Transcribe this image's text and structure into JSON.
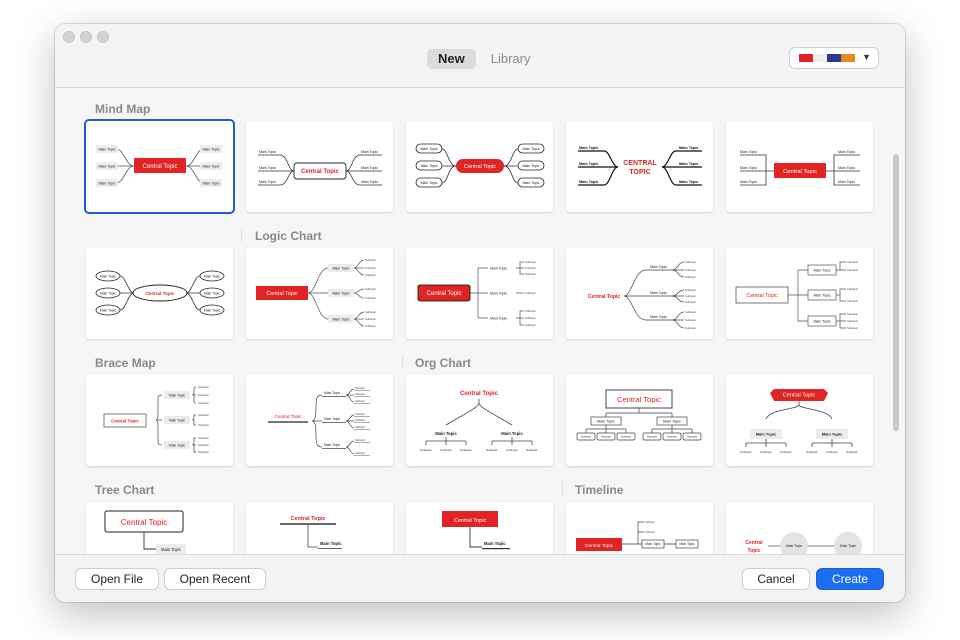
{
  "tabs": [
    {
      "label": "New",
      "active": true
    },
    {
      "label": "Library",
      "active": false
    }
  ],
  "theme_swatches": [
    "#e02424",
    "#f0f0f0",
    "#2a3a9a",
    "#e88a1a"
  ],
  "sections": {
    "mind_map": "Mind Map",
    "logic_chart": "Logic Chart",
    "brace_map": "Brace Map",
    "org_chart": "Org Chart",
    "tree_chart": "Tree Chart",
    "timeline": "Timeline"
  },
  "thumb_text": {
    "central": "Central Topic",
    "central_upper": "CENTRAL TOPIC",
    "central_line1": "CENTRAL",
    "central_line2": "TOPIC",
    "central_split1": "Central",
    "central_split2": "Topic",
    "main": "Main Topic",
    "main_bold": "Main Topic",
    "sub": "Subtopic"
  },
  "footer": {
    "open_file": "Open File",
    "open_recent": "Open Recent",
    "cancel": "Cancel",
    "create": "Create"
  },
  "colors": {
    "accent": "#1c6ef2",
    "brand_red": "#e02424"
  }
}
